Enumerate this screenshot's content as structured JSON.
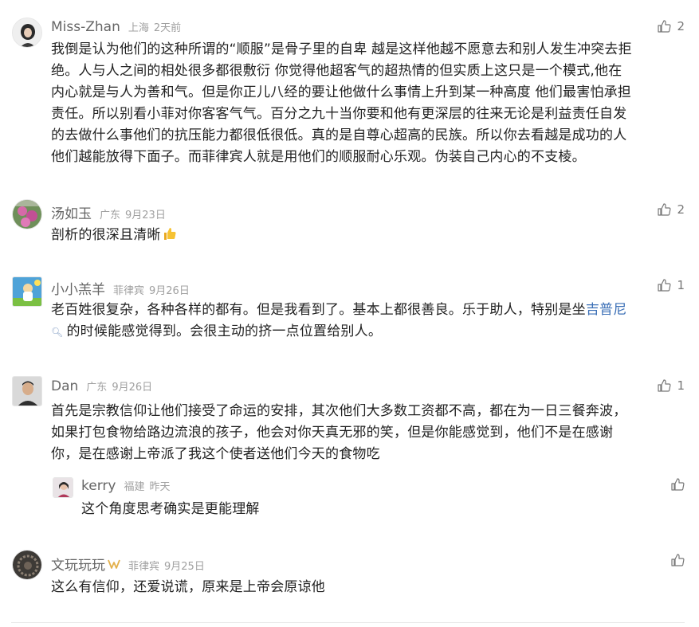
{
  "comments": [
    {
      "user": "Miss-Zhan",
      "location": "上海",
      "time": "2天前",
      "likes": "2",
      "lines": [
        "我倒是认为他们的这种所谓的“顺服”是骨子里的自卑 越是这样他越不愿意去和别人发生冲突去拒",
        "绝。人与人之间的相处很多都很敷衍 你觉得他超客气的超热情的但实质上这只是一个模式,他在",
        "内心就是与人为善和气。但是你正儿八经的要让他做什么事情上升到某一种高度 他们最害怕承担",
        "责任。所以别看小菲对你客客气气。百分之九十当你要和他有更深层的往来无论是利益责任自发",
        "的去做什么事他们的抗压能力都很低很低。真的是自尊心超高的民族。所以你去看越是成功的人",
        "他们越能放得下面子。而菲律宾人就是用他们的顺服耐心乐观。伪装自己内心的不支棱。"
      ]
    },
    {
      "user": "汤如玉",
      "location": "广东",
      "time": "9月23日",
      "likes": "2",
      "text": "剖析的很深且清晰"
    },
    {
      "user": "小小羔羊",
      "location": "菲律宾",
      "time": "9月26日",
      "likes": "1",
      "line1": "老百姓很复杂，各种各样的都有。但是我看到了。基本上都很善良。乐于助人，特别是坐",
      "link": "吉普尼",
      "line2": "的时候能感觉得到。会很主动的挤一点位置给别人。"
    },
    {
      "user": "Dan",
      "location": "广东",
      "time": "9月26日",
      "likes": "1",
      "lines": [
        "首先是宗教信仰让他们接受了命运的安排，其次他们大多数工资都不高，都在为一日三餐奔波，",
        "如果打包食物给路边流浪的孩子，他会对你天真无邪的笑，但是你能感觉到，他们不是在感谢",
        "你，是在感谢上帝派了我这个使者送他们今天的食物吃"
      ],
      "reply": {
        "user": "kerry",
        "location": "福建",
        "time": "昨天",
        "text": "这个角度思考确实是更能理解"
      }
    },
    {
      "user": "文玩玩玩",
      "location": "菲律宾",
      "time": "9月25日",
      "text": "这么有信仰，还爱说谎，原来是上帝会原谅他"
    }
  ],
  "colors": {
    "text": "#222222",
    "meta": "#a0a0a0",
    "username": "#666666",
    "link": "#3b6fb6"
  }
}
